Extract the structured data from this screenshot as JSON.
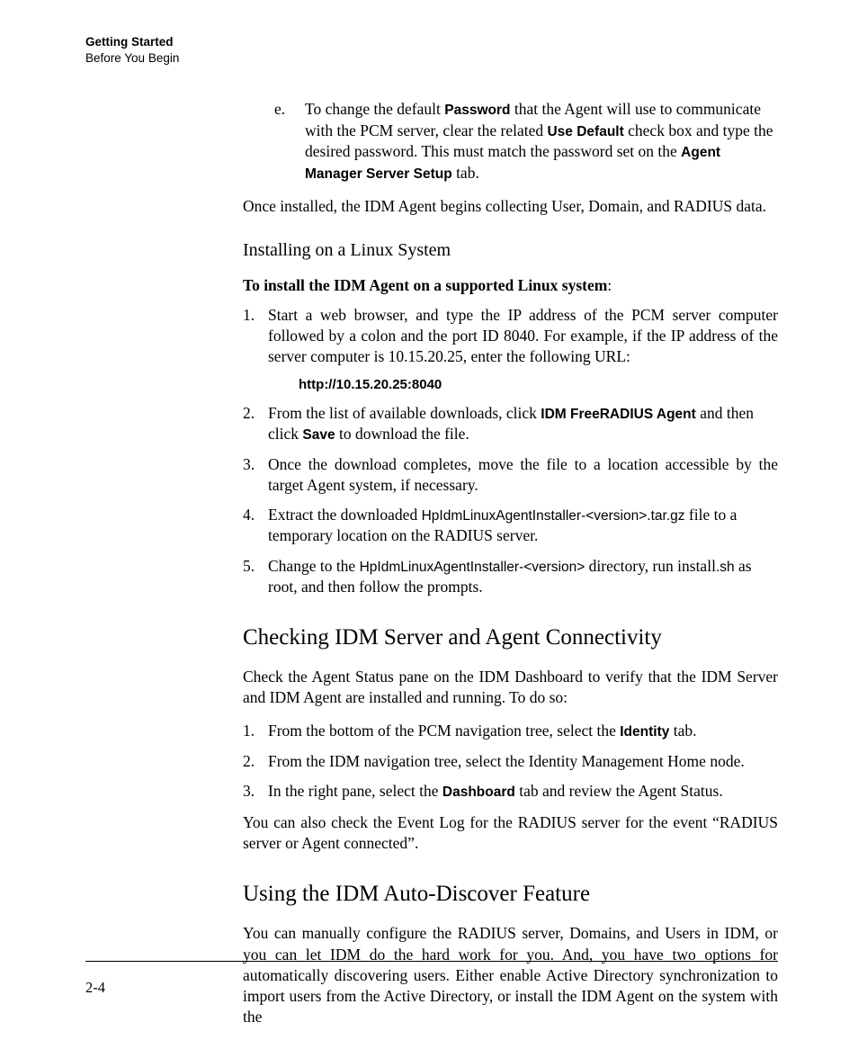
{
  "header": {
    "chapter": "Getting Started",
    "section": "Before You Begin"
  },
  "item_e": {
    "marker": "e.",
    "seg1": "To change the default ",
    "bold1": "Password",
    "seg2": " that the Agent will use to communicate with the PCM server, clear the related ",
    "bold2": "Use Default",
    "seg3": " check box and type the desired password. This must match the password set on the ",
    "bold3": "Agent Manager Server Setup",
    "seg4": " tab."
  },
  "after_e": "Once installed, the IDM Agent begins collecting User, Domain, and RADIUS data.",
  "linux": {
    "subhead": "Installing on a Linux System",
    "intro": "To install the IDM Agent on a supported Linux system",
    "intro_colon": ":",
    "items": {
      "n1": {
        "marker": "1.",
        "text": "Start a web browser, and type the IP address of the PCM server computer followed by a colon and the port ID 8040. For example, if the IP address of the server computer is 10.15.20.25, enter the following URL:"
      },
      "url": "http://10.15.20.25:8040",
      "n2": {
        "marker": "2.",
        "seg1": "From the list of available downloads, click ",
        "bold1": "IDM FreeRADIUS Agent",
        "seg2": " and then click ",
        "bold2": "Save",
        "seg3": " to download the file."
      },
      "n3": {
        "marker": "3.",
        "text": "Once the download completes, move the file to a location accessible by the target Agent system, if necessary."
      },
      "n4": {
        "marker": "4.",
        "seg1": "Extract the downloaded ",
        "code1": "HpIdmLinuxAgentInstaller-<version>.tar.gz",
        "seg2": " file to a temporary location on the RADIUS server."
      },
      "n5": {
        "marker": "5.",
        "seg1": "Change to the ",
        "code1": "HpIdmLinuxAgentInstaller-<version>",
        "seg2": " directory, run install",
        "code2": ".sh",
        "seg3": " as root, and then follow the prompts."
      }
    }
  },
  "check": {
    "heading": "Checking IDM Server and Agent Connectivity",
    "intro": "Check the Agent Status pane on the IDM Dashboard to verify that the IDM Server and IDM Agent are installed and running. To do so:",
    "n1": {
      "marker": "1.",
      "seg1": " From the bottom of the PCM navigation tree, select the ",
      "bold1": "Identity",
      "seg2": " tab."
    },
    "n2": {
      "marker": "2.",
      "text": " From the IDM navigation tree, select the Identity Management Home node."
    },
    "n3": {
      "marker": "3.",
      "seg1": "In the right pane, select the ",
      "bold1": "Dashboard",
      "seg2": " tab and review the Agent Status."
    },
    "outro": "You can also check the Event Log for the RADIUS server for the event “RADIUS server or Agent connected”."
  },
  "auto": {
    "heading": "Using the IDM Auto-Discover Feature",
    "para": "You can manually configure the RADIUS server, Domains, and Users in IDM, or you can let IDM do the hard work for you. And, you have two options for automatically discovering users. Either enable Active Directory synchronization to import users from the Active Directory, or install the IDM Agent on the system with the"
  },
  "page_number": "2-4"
}
